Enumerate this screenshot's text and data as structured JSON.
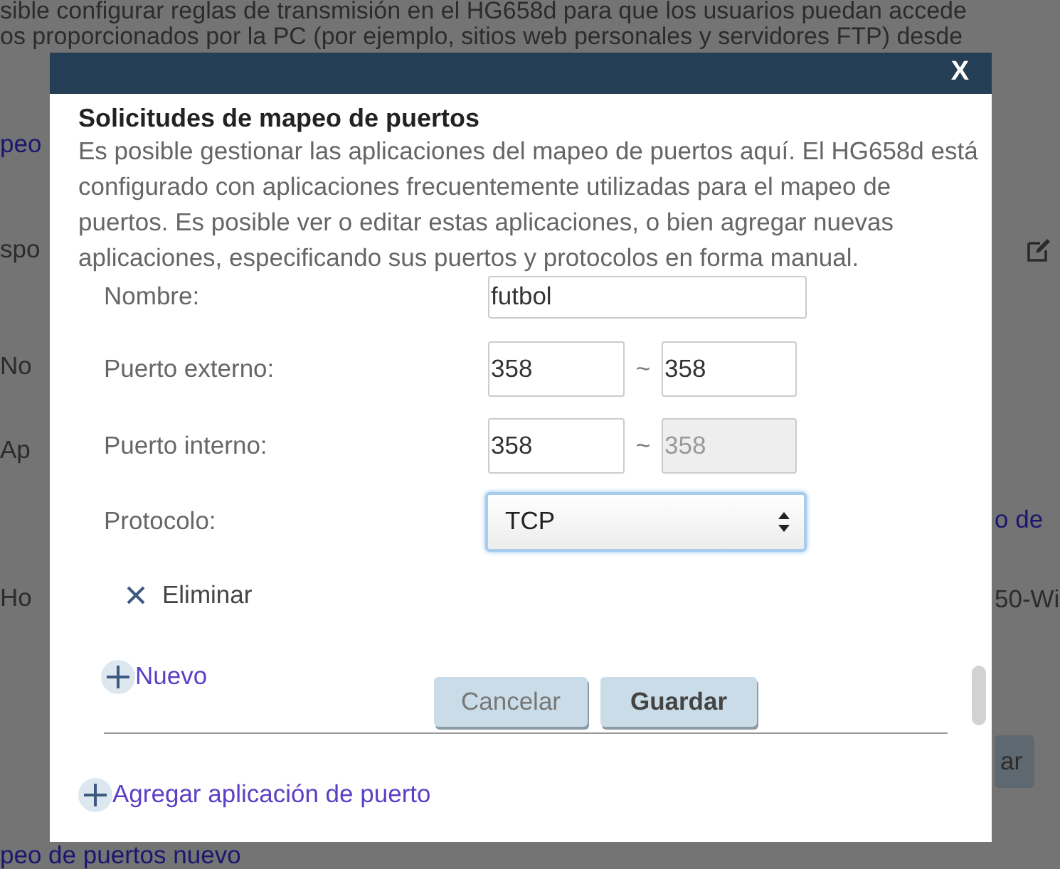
{
  "page": {
    "intro_lines": [
      "sible configurar reglas de transmisión en el HG658d para que los usuarios puedan accede",
      "os proporcionados por la PC (por ejemplo, sitios web personales y servidores FTP) desde"
    ],
    "rows": [
      {
        "left": {
          "kind": "link",
          "text": "peo"
        }
      },
      {
        "left": {
          "kind": "text",
          "text": "spo"
        },
        "right": {
          "kind": "edit"
        }
      },
      {
        "left": {
          "kind": "text",
          "text": "No"
        }
      },
      {
        "left": {
          "kind": "text",
          "text": "Ap"
        }
      },
      {
        "right": {
          "kind": "link",
          "text": "o de"
        }
      },
      {
        "left": {
          "kind": "text",
          "text": "Ho"
        },
        "right": {
          "kind": "text",
          "text": "50-Wi"
        }
      },
      {
        "right": {
          "kind": "button",
          "text": "ar"
        }
      },
      {
        "left": {
          "kind": "link",
          "text": "peo de puertos nuevo"
        }
      }
    ]
  },
  "dialog": {
    "close": "X",
    "title": "Solicitudes de mapeo de puertos",
    "description": "Es posible gestionar las aplicaciones del mapeo de puertos aquí. El HG658d está configurado con aplicaciones frecuentemente utilizadas para el mapeo de puertos. Es posible ver o editar estas aplicaciones, o bien agregar nuevas aplicaciones, especificando sus puertos y protocolos en forma manual.",
    "fields": [
      {
        "kind": "text",
        "label": "Nombre:",
        "value": "futbol"
      },
      {
        "kind": "range",
        "label": "Puerto externo:",
        "from": "358",
        "separator": "~",
        "to": "358",
        "to_disabled": false
      },
      {
        "kind": "range",
        "label": "Puerto interno:",
        "from": "358",
        "separator": "~",
        "to": "358",
        "to_disabled": true
      },
      {
        "kind": "select",
        "label": "Protocolo:",
        "value": "TCP",
        "focused": true
      }
    ],
    "remove_label": "Eliminar",
    "new_label": "Nuevo",
    "buttons": [
      {
        "label": "Cancelar",
        "primary": false
      },
      {
        "label": "Guardar",
        "primary": true
      }
    ],
    "add_app_label": "Agregar aplicación de puerto"
  }
}
